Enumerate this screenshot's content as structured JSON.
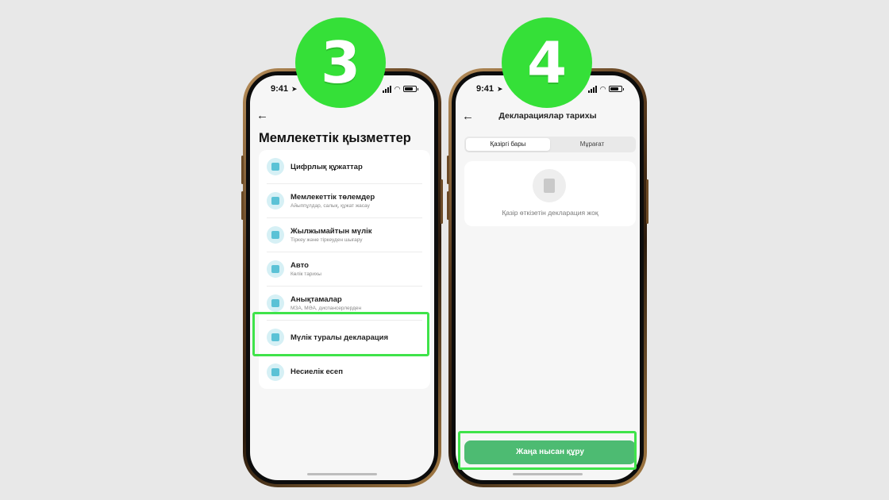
{
  "badges": {
    "left": "3",
    "right": "4"
  },
  "status_bar": {
    "time": "9:41"
  },
  "screen_left": {
    "title": "Мемлекеттік қызметтер",
    "items": [
      {
        "title": "Цифрлық құжаттар",
        "subtitle": ""
      },
      {
        "title": "Мемлекеттік төлемдер",
        "subtitle": "Айыппұлдар, салық, құжат жасау"
      },
      {
        "title": "Жылжымайтын мүлік",
        "subtitle": "Тіркеу және тіркеуден шығару"
      },
      {
        "title": "Авто",
        "subtitle": "Көлік тарихы"
      },
      {
        "title": "Анықтамалар",
        "subtitle": "МЗА, МӘА, диспансерлерден"
      },
      {
        "title": "Мүлік туралы декларация",
        "subtitle": ""
      },
      {
        "title": "Несиелік есеп",
        "subtitle": ""
      }
    ]
  },
  "screen_right": {
    "title": "Декларациялар тарихы",
    "tabs": [
      "Қазіргі бары",
      "Мұрағат"
    ],
    "active_tab": 0,
    "empty_text": "Қазір өткізетін декларация жоқ",
    "button_label": "Жаңа нысан құру"
  },
  "colors": {
    "badge": "#35e038",
    "highlight": "#3fe34a",
    "primary_button": "#4dbb72",
    "icon_bg": "#d6f0f5",
    "icon_fg": "#5bc2d6"
  }
}
